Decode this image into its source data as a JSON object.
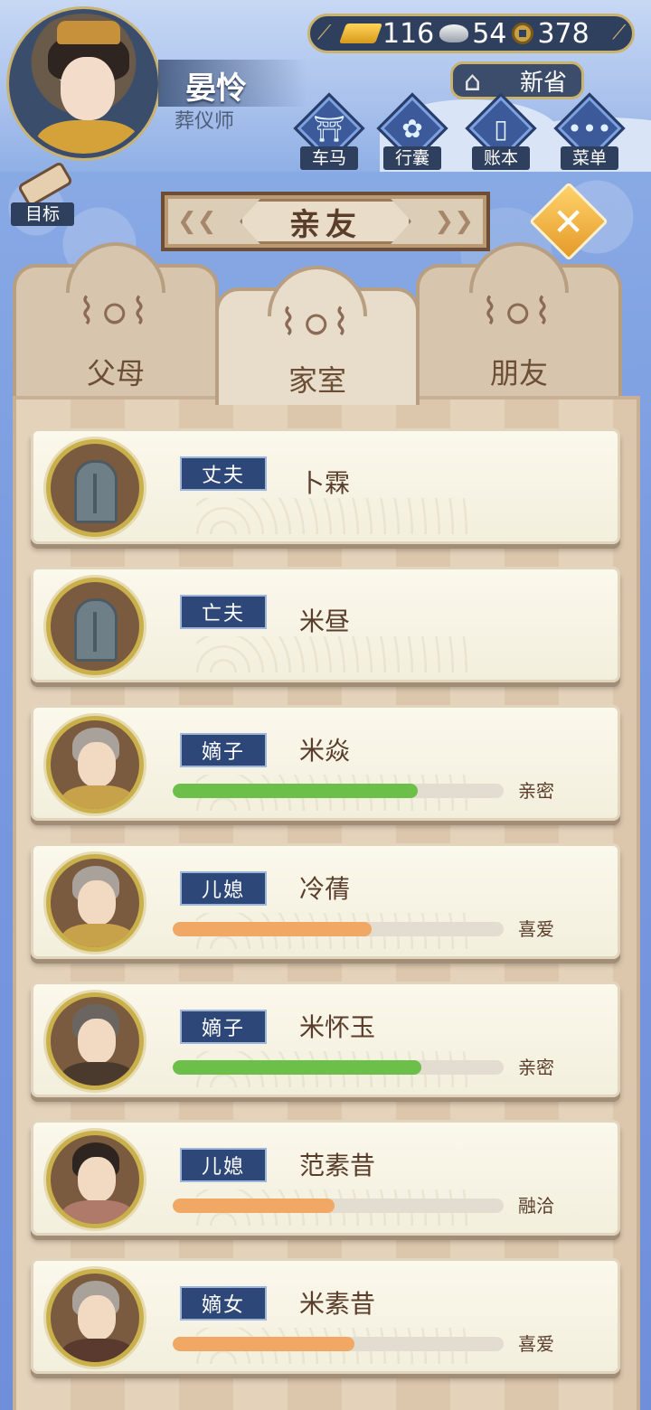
{
  "player": {
    "name": "晏怜",
    "title": "葬仪师"
  },
  "currency": {
    "gold": "116",
    "silver": "54",
    "coins": "378",
    "gold_icon": "gold-ingot-icon",
    "silver_icon": "silver-ingot-icon",
    "coin_icon": "copper-coin-icon"
  },
  "xinsheng_label": "新省",
  "menu": [
    {
      "label": "车马",
      "icon": "carriage-icon"
    },
    {
      "label": "行囊",
      "icon": "bag-icon"
    },
    {
      "label": "账本",
      "icon": "ledger-icon"
    },
    {
      "label": "菜单",
      "icon": "more-icon"
    }
  ],
  "goal_label": "目标",
  "page_title": "亲友",
  "tabs": [
    {
      "label": "父母"
    },
    {
      "label": "家室"
    },
    {
      "label": "朋友"
    }
  ],
  "active_tab": "家室",
  "relatives": [
    {
      "role": "丈夫",
      "name": "卜霖",
      "portrait": "tombstone"
    },
    {
      "role": "亡夫",
      "name": "米昼",
      "portrait": "tombstone"
    },
    {
      "role": "嫡子",
      "name": "米焱",
      "portrait": "person",
      "relation": "亲密",
      "affinity": 0.74,
      "bar_color": "#6cc04a"
    },
    {
      "role": "儿媳",
      "name": "冷蒨",
      "portrait": "person",
      "relation": "喜爱",
      "affinity": 0.6,
      "bar_color": "#f0a864"
    },
    {
      "role": "嫡子",
      "name": "米怀玉",
      "portrait": "person",
      "relation": "亲密",
      "affinity": 0.75,
      "bar_color": "#6cc04a"
    },
    {
      "role": "儿媳",
      "name": "范素昔",
      "portrait": "person",
      "relation": "融洽",
      "affinity": 0.49,
      "bar_color": "#f0a864"
    },
    {
      "role": "嫡女",
      "name": "米素昔",
      "portrait": "person",
      "relation": "喜爱",
      "affinity": 0.55,
      "bar_color": "#f0a864"
    }
  ]
}
